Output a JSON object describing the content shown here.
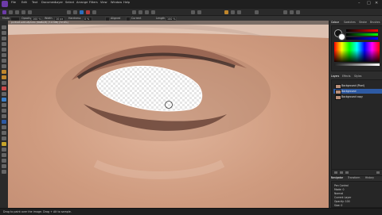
{
  "menubar": {
    "items": [
      "File",
      "Edit",
      "Text",
      "Document",
      "Layer",
      "Select",
      "Arrange",
      "Filters",
      "View",
      "Window",
      "Help"
    ],
    "window_controls": [
      "–",
      "□",
      "✕"
    ]
  },
  "context_toolbar": {
    "mode_label": "Mode",
    "opacity_label": "Opacity",
    "opacity_value": "100 %",
    "width_label": "Width",
    "width_value": "10 px",
    "hardness_label": "Hardness",
    "hardness_value": "0 %",
    "aligned_label": "Aligned",
    "current_layer_label": "Current",
    "length_label": "Length",
    "length_value": "100 %"
  },
  "document": {
    "title": "portrait-edit.afphoto (RGBA/8) (7.6 MB) (72.6%)"
  },
  "panels": {
    "top_tabs": [
      "Colour",
      "Swatches",
      "Stroke",
      "Brushes"
    ],
    "layer_tabs": [
      "Layers",
      "Effects",
      "Styles"
    ],
    "layers": [
      {
        "name": "Background (Pixel)"
      },
      {
        "name": "Background"
      },
      {
        "name": "Background copy"
      }
    ],
    "bottom_tabs": [
      "Navigator",
      "Transform",
      "History"
    ],
    "properties": [
      "Pen Control",
      "Mode: 0",
      "Normal",
      "Current Layer",
      "Opacity: 100",
      "Size: 0"
    ]
  },
  "statusbar": {
    "text": "Drag to paint over the image. Drag + Alt to sample."
  }
}
